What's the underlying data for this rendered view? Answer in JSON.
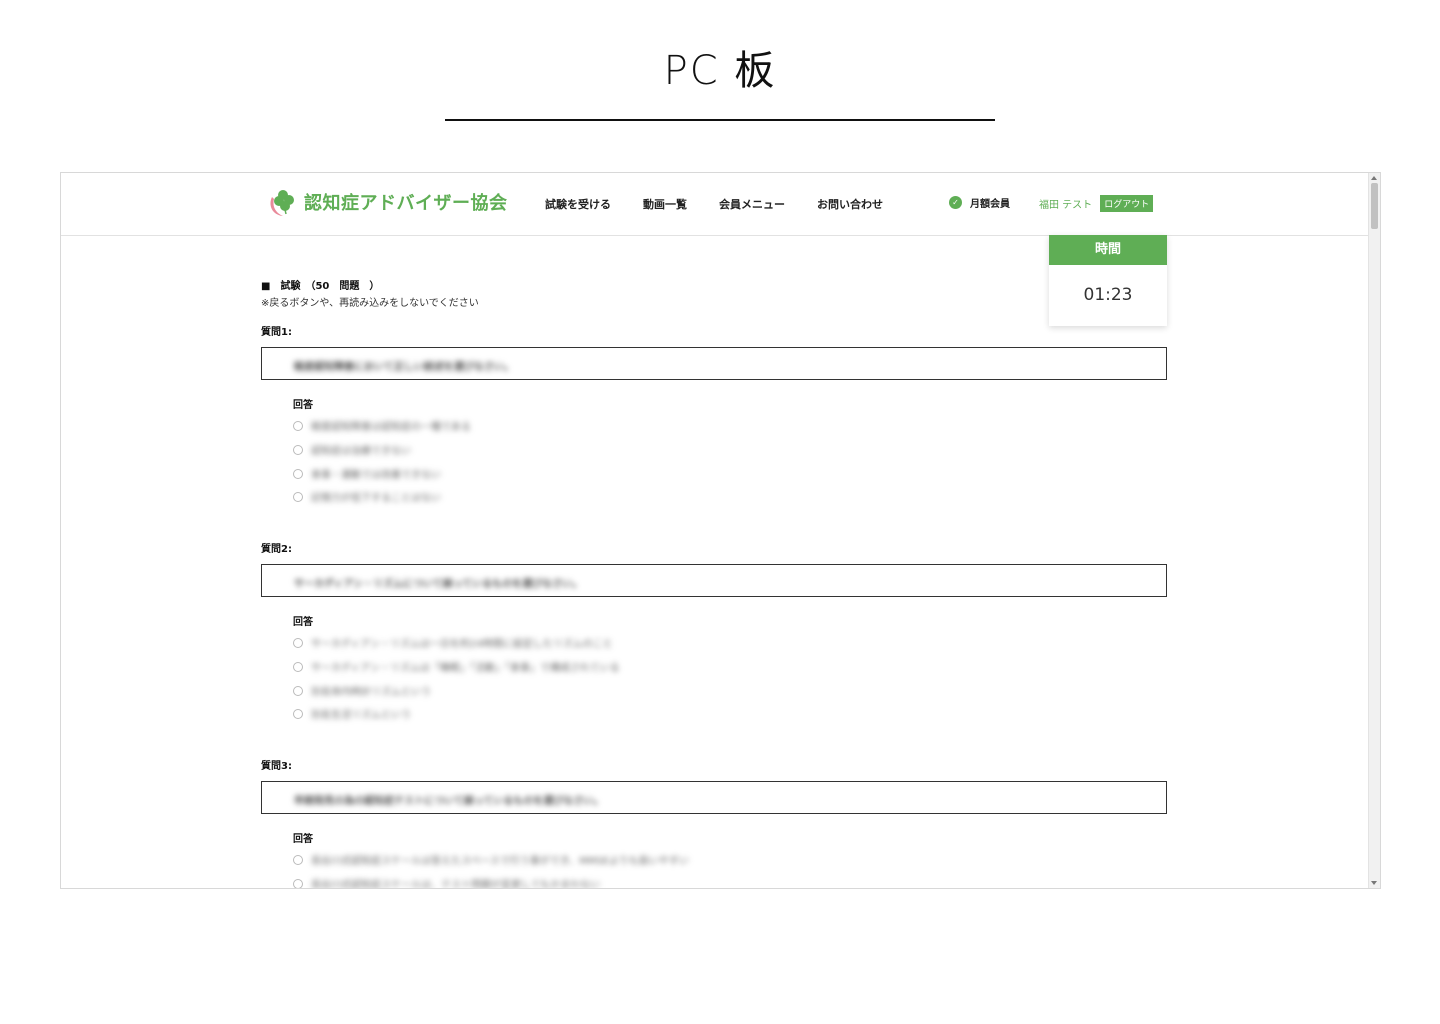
{
  "page_heading": "PC 板",
  "header": {
    "logo_text": "認知症アドバイザー協会",
    "nav": [
      "試験を受ける",
      "動画一覧",
      "会員メニュー",
      "お問い合わせ"
    ],
    "member_label": "月額会員",
    "user_name": "福田 テスト",
    "logout_label": "ログアウト"
  },
  "timer": {
    "label": "時間",
    "value": "01:23"
  },
  "exam": {
    "title": "■　試験　（50　問題　）",
    "note": "※戻るボタンや、再読み込みをしないでください"
  },
  "questions": [
    {
      "label": "質問1:",
      "text": "軽度認知障害において正しい説述を選びなさい。",
      "answer_head": "回答",
      "options": [
        "軽度認知障害は認知症の一種である",
        "認知症は治療できない",
        "食事・運動では改善できない",
        "記憶力が低下することはない"
      ]
    },
    {
      "label": "質問2:",
      "text": "サーカディアン・リズムについて誤っているものを選びなさい。",
      "answer_head": "回答",
      "options": [
        "サーカディアン・リズムは一日を約24時間に設定したリズムのこと",
        "サーカディアン・リズムは「睡眠」「活動」「食事」で構成されている",
        "別名体内時計リズムという",
        "別名生活リズムという"
      ]
    },
    {
      "label": "質問3:",
      "text": "早期発見の為の認知症テストについて誤っているものを選びなさい。",
      "answer_head": "回答",
      "options": [
        "長谷川式認知症スケールは答えたスペースで行う事ができ、MMSEよりも扱いやすい",
        "長谷川式認知症スケールは、テスト問題が変更してもかまわない"
      ]
    }
  ]
}
